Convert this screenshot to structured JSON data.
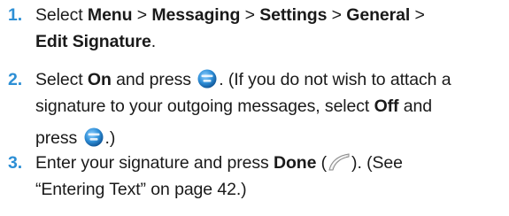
{
  "steps": [
    {
      "number": "1.",
      "t1": "Select ",
      "b1": "Menu",
      "t2": " > ",
      "b2": "Messaging",
      "t3": " > ",
      "b3": "Settings",
      "t4": " > ",
      "b4": "General",
      "t5": " >",
      "b5": "Edit Signature",
      "t6": "."
    },
    {
      "number": "2.",
      "t1": "Select ",
      "b1": "On",
      "t2": " and press ",
      "icon1": "menu-ok-key-icon",
      "t3": ". (If you do not wish to attach a signature to your outgoing messages, select ",
      "b2": "Off",
      "t4": " and",
      "t5": "press ",
      "icon2": "menu-ok-key-icon",
      "t6": ".)"
    },
    {
      "number": "3.",
      "t1": "Enter your signature and press ",
      "b1": "Done",
      "t2": " (",
      "icon1": "left-softkey-icon",
      "t3": "). (See",
      "t4": "“Entering Text” on page 42.)"
    }
  ],
  "colors": {
    "step_number": "#2d8fd5",
    "body_text": "#1a1a1a",
    "menu_key": "#2f8fd8"
  }
}
